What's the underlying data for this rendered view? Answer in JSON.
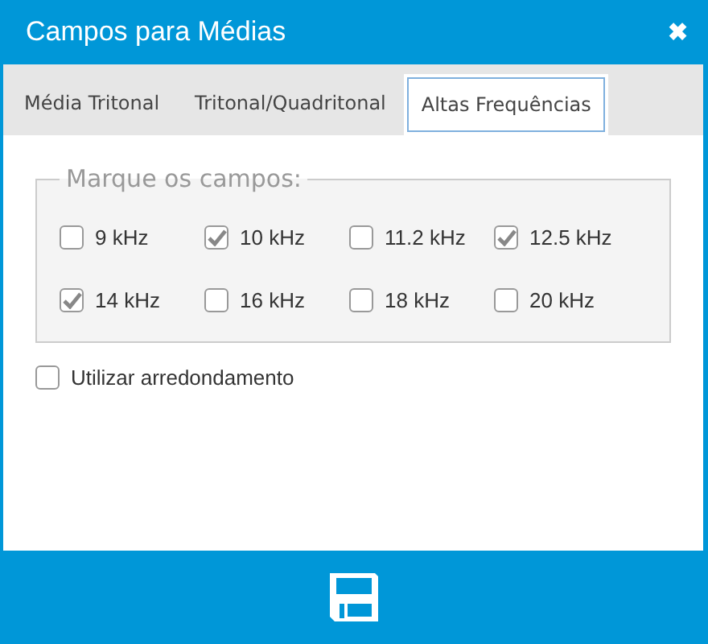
{
  "window": {
    "title": "Campos para Médias",
    "close": "✖"
  },
  "tabs": [
    {
      "label": "Média Tritonal",
      "selected": false
    },
    {
      "label": "Tritonal/Quadritonal",
      "selected": false
    },
    {
      "label": "Altas Frequências",
      "selected": true
    }
  ],
  "fieldset": {
    "legend": "Marque os campos:",
    "options": [
      {
        "label": "9 kHz",
        "checked": false
      },
      {
        "label": "10 kHz",
        "checked": true
      },
      {
        "label": "11.2 kHz",
        "checked": false
      },
      {
        "label": "12.5 kHz",
        "checked": true
      },
      {
        "label": "14 kHz",
        "checked": true
      },
      {
        "label": "16 kHz",
        "checked": false
      },
      {
        "label": "18 kHz",
        "checked": false
      },
      {
        "label": "20 kHz",
        "checked": false
      }
    ]
  },
  "rounding": {
    "label": "Utilizar arredondamento",
    "checked": false
  }
}
